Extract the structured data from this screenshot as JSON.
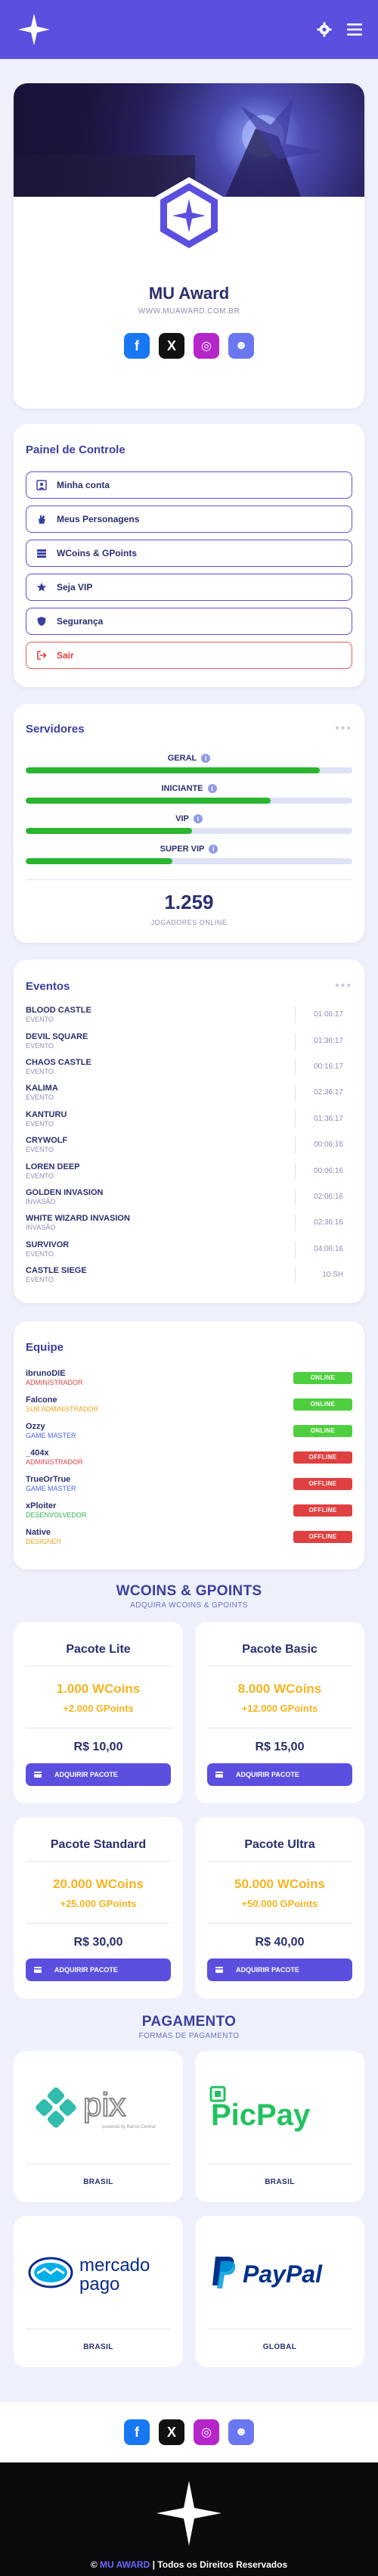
{
  "header": {
    "logo_icon": "star-logo",
    "settings_icon": "gear-icon",
    "menu_icon": "hamburger-icon"
  },
  "hero": {
    "title": "MU Award",
    "url": "WWW.MUAWARD.COM.BR"
  },
  "social": [
    {
      "name": "facebook",
      "glyph": "f"
    },
    {
      "name": "x",
      "glyph": "X"
    },
    {
      "name": "instagram",
      "glyph": "◎"
    },
    {
      "name": "discord",
      "glyph": "☻"
    }
  ],
  "panel": {
    "title": "Painel de Controle",
    "items": [
      {
        "label": "Minha conta",
        "icon": "user-icon"
      },
      {
        "label": "Meus Personagens",
        "icon": "hand-icon"
      },
      {
        "label": "WCoins & GPoints",
        "icon": "coins-icon"
      },
      {
        "label": "Seja VIP",
        "icon": "star-icon"
      },
      {
        "label": "Segurança",
        "icon": "shield-icon"
      },
      {
        "label": "Sair",
        "icon": "logout-icon"
      }
    ]
  },
  "servers": {
    "title": "Servidores",
    "items": [
      {
        "name": "GERAL",
        "fill": 0.9
      },
      {
        "name": "INICIANTE",
        "fill": 0.75
      },
      {
        "name": "VIP",
        "fill": 0.51
      },
      {
        "name": "SUPER VIP",
        "fill": 0.45
      }
    ],
    "online_count": "1.259",
    "online_label": "JOGADORES ONLINE"
  },
  "events": {
    "title": "Eventos",
    "items": [
      {
        "name": "BLOOD CASTLE",
        "type": "EVENTO",
        "time": "01:06:17"
      },
      {
        "name": "DEVIL SQUARE",
        "type": "EVENTO",
        "time": "01:36:17"
      },
      {
        "name": "CHAOS CASTLE",
        "type": "EVENTO",
        "time": "00:16:17"
      },
      {
        "name": "KALIMA",
        "type": "EVENTO",
        "time": "02:36:17"
      },
      {
        "name": "KANTURU",
        "type": "EVENTO",
        "time": "01:36:17"
      },
      {
        "name": "CRYWOLF",
        "type": "EVENTO",
        "time": "00:06:16"
      },
      {
        "name": "LOREN DEEP",
        "type": "EVENTO",
        "time": "00:06:16"
      },
      {
        "name": "GOLDEN INVASION",
        "type": "INVASÃO",
        "time": "02:06:16"
      },
      {
        "name": "WHITE WIZARD INVASION",
        "type": "INVASÃO",
        "time": "02:36:16"
      },
      {
        "name": "SURVIVOR",
        "type": "EVENTO",
        "time": "04:06:16"
      },
      {
        "name": "CASTLE SIEGE",
        "type": "EVENTO",
        "time": "10 SH"
      }
    ]
  },
  "team": {
    "title": "Equipe",
    "members": [
      {
        "name": "ibrunoDIE",
        "role": "ADMINISTRADOR",
        "role_color": "#e04040",
        "status": "ONLINE",
        "status_color": "#4fcf3f"
      },
      {
        "name": "Falcone",
        "role": "SUB ADMINISTRADOR",
        "role_color": "#f5a020",
        "status": "ONLINE",
        "status_color": "#4fcf3f"
      },
      {
        "name": "Ozzy",
        "role": "GAME MASTER",
        "role_color": "#4a63e0",
        "status": "ONLINE",
        "status_color": "#4fcf3f"
      },
      {
        "name": "_404x",
        "role": "ADMINISTRADOR",
        "role_color": "#e04040",
        "status": "OFFLINE",
        "status_color": "#e04040"
      },
      {
        "name": "TrueOrTrue",
        "role": "GAME MASTER",
        "role_color": "#4a63e0",
        "status": "OFFLINE",
        "status_color": "#e04040"
      },
      {
        "name": "xPloiter",
        "role": "DESENVOLVEDOR",
        "role_color": "#2fb54a",
        "status": "OFFLINE",
        "status_color": "#e04040"
      },
      {
        "name": "Native",
        "role": "DESIGNER",
        "role_color": "#e8a020",
        "status": "OFFLINE",
        "status_color": "#e04040"
      }
    ]
  },
  "packages": {
    "title": "WCOINS & GPOINTS",
    "subtitle": "ADQUIRA WCOINS & GPOINTS",
    "buy_label": "ADQUIRIR PACOTE",
    "items": [
      {
        "name": "Pacote Lite",
        "wcoins": "1.000 WCoins",
        "gpoints": "+2.000 GPoints",
        "price": "R$ 10,00"
      },
      {
        "name": "Pacote Basic",
        "wcoins": "8.000 WCoins",
        "gpoints": "+12.000 GPoints",
        "price": "R$ 15,00"
      },
      {
        "name": "Pacote Standard",
        "wcoins": "20.000 WCoins",
        "gpoints": "+25.000 GPoints",
        "price": "R$ 30,00"
      },
      {
        "name": "Pacote Ultra",
        "wcoins": "50.000 WCoins",
        "gpoints": "+50.000 GPoints",
        "price": "R$ 40,00"
      }
    ]
  },
  "payment": {
    "title": "PAGAMENTO",
    "subtitle": "FORMAS DE PAGAMENTO",
    "items": [
      {
        "name": "pix",
        "country": "BRASIL",
        "pix_tagline": "powered by Banco Central"
      },
      {
        "name": "PicPay",
        "country": "BRASIL"
      },
      {
        "name": "mercado",
        "name2": "pago",
        "country": "BRASIL"
      },
      {
        "name": "PayPal",
        "country": "GLOBAL"
      }
    ]
  },
  "footer": {
    "brand": "MU AWARD",
    "copyright_prefix": "©",
    "copyright_suffix": "| Todos os Direitos Reservados"
  }
}
